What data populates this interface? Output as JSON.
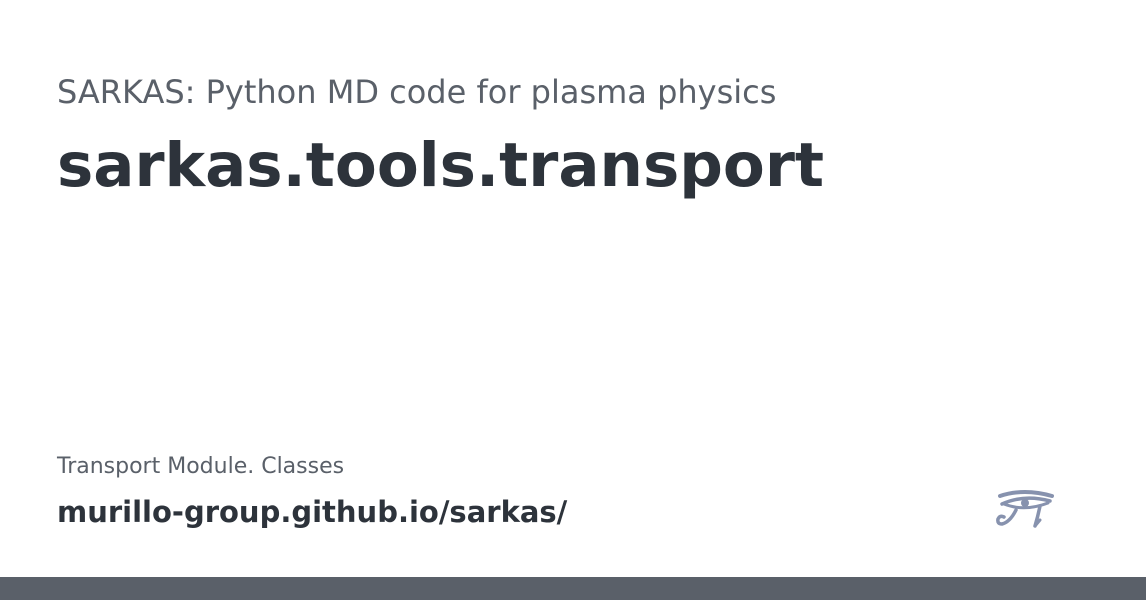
{
  "card": {
    "site_name": "SARKAS: Python MD code for plasma physics",
    "page_title": "sarkas.tools.transport",
    "description": "Transport Module. Classes",
    "site_url": "murillo-group.github.io/sarkas/",
    "logo_icon": "eye-of-horus-icon"
  },
  "colors": {
    "background": "#ffffff",
    "heading": "#2d333b",
    "muted_text": "#5a6069",
    "logo": "#8792ae",
    "bottom_bar": "#5a6069"
  }
}
